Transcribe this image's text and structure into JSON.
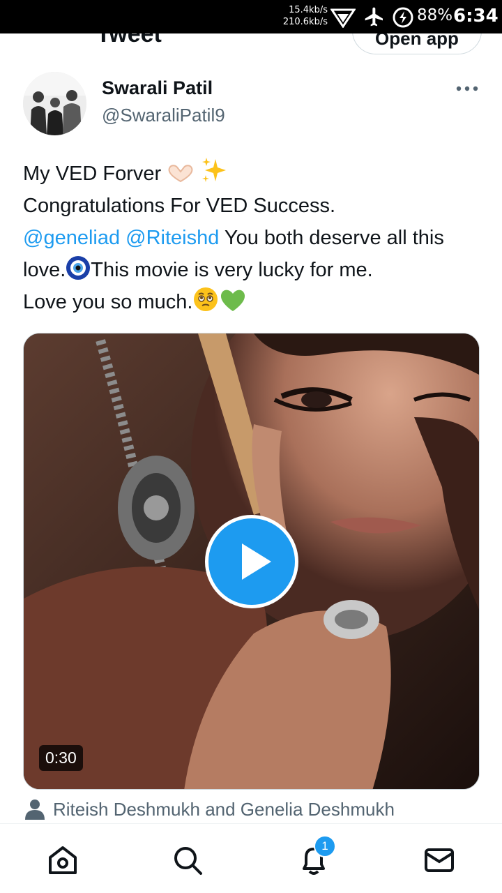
{
  "status_bar": {
    "net_down": "15.4kb/s",
    "net_up": "210.6kb/s",
    "battery": "88%",
    "time": "6:34",
    "icons": [
      "data-saver-icon",
      "airplane-icon",
      "battery-saver-icon"
    ]
  },
  "header": {
    "title": "Tweet",
    "open_app_label": "Open app"
  },
  "author": {
    "name": "Swarali Patil",
    "handle": "@SwaraliPatil9"
  },
  "tweet": {
    "line1": "My VED Forver",
    "line2": "Congratulations For VED Success.",
    "mention1": "@geneliad",
    "mention2": "@Riteishd",
    "line3_rest": " You both deserve all this love.",
    "line3_after_eye": "This movie is very lucky for me.",
    "line4": "Love you so much."
  },
  "video": {
    "duration": "0:30"
  },
  "tagged": {
    "text": "Riteish Deshmukh and Genelia Deshmukh"
  },
  "nav": {
    "notifications_badge": "1",
    "items": [
      "home-icon",
      "search-icon",
      "notifications-icon",
      "messages-icon"
    ]
  },
  "colors": {
    "accent": "#1d9bf0",
    "text": "#0f1419",
    "secondary": "#536471"
  }
}
